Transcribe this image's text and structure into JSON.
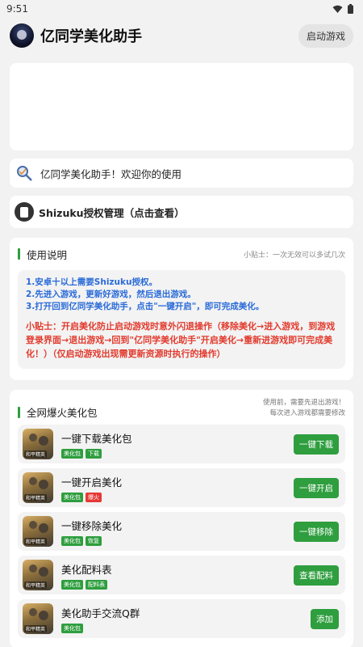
{
  "status_bar": {
    "time": "9:51"
  },
  "app_bar": {
    "title": "亿同学美化助手",
    "launch_button": "启动游戏"
  },
  "welcome": {
    "text": "亿同学美化助手！欢迎你的使用"
  },
  "shizuku": {
    "text": "Shizuku授权管理（点击查看）"
  },
  "usage": {
    "title": "使用说明",
    "tip": "小贴士：一次无效可以多试几次",
    "steps": [
      "1.安卓十以上需要Shizuku授权。",
      "2.先进入游戏，更新好游戏，然后退出游戏。",
      "3.打开回到亿同学美化助手，点击\"一键开启\"，即可完成美化。"
    ],
    "warning": "小贴士：开启美化防止启动游戏时意外闪退操作（移除美化→进入游戏，到游戏登录界面→退出游戏→回到\"亿同学美化助手\"开启美化→重新进游戏即可完成美化！）（仅启动游戏出现需更新资源时执行的操作）"
  },
  "packs": {
    "title": "全网爆火美化包",
    "tip_line1": "使用前，需要先退出游戏！",
    "tip_line2": "每次进入游戏都需要修改",
    "thumb_label": "和平精英",
    "items": [
      {
        "name": "一键下载美化包",
        "button": "一键下载",
        "tags": [
          {
            "text": "美化包",
            "color": "#2e9e3e"
          },
          {
            "text": "下载",
            "color": "#2e9e3e"
          }
        ]
      },
      {
        "name": "一键开启美化",
        "button": "一键开启",
        "tags": [
          {
            "text": "美化包",
            "color": "#2e9e3e"
          },
          {
            "text": "爆火",
            "color": "#e53935"
          }
        ]
      },
      {
        "name": "一键移除美化",
        "button": "一键移除",
        "tags": [
          {
            "text": "美化包",
            "color": "#2e9e3e"
          },
          {
            "text": "恢复",
            "color": "#2e9e3e"
          }
        ]
      },
      {
        "name": "美化配料表",
        "button": "查看配料",
        "tags": [
          {
            "text": "美化包",
            "color": "#2e9e3e"
          },
          {
            "text": "配料表",
            "color": "#2e9e3e"
          }
        ]
      },
      {
        "name": "美化助手交流Q群",
        "button": "添加",
        "tags": [
          {
            "text": "美化包",
            "color": "#2e9e3e"
          }
        ]
      }
    ]
  },
  "colors": {
    "accent": "#2e9e3e",
    "step_blue": "#2a6bd8",
    "warning_red": "#e23b2e"
  }
}
